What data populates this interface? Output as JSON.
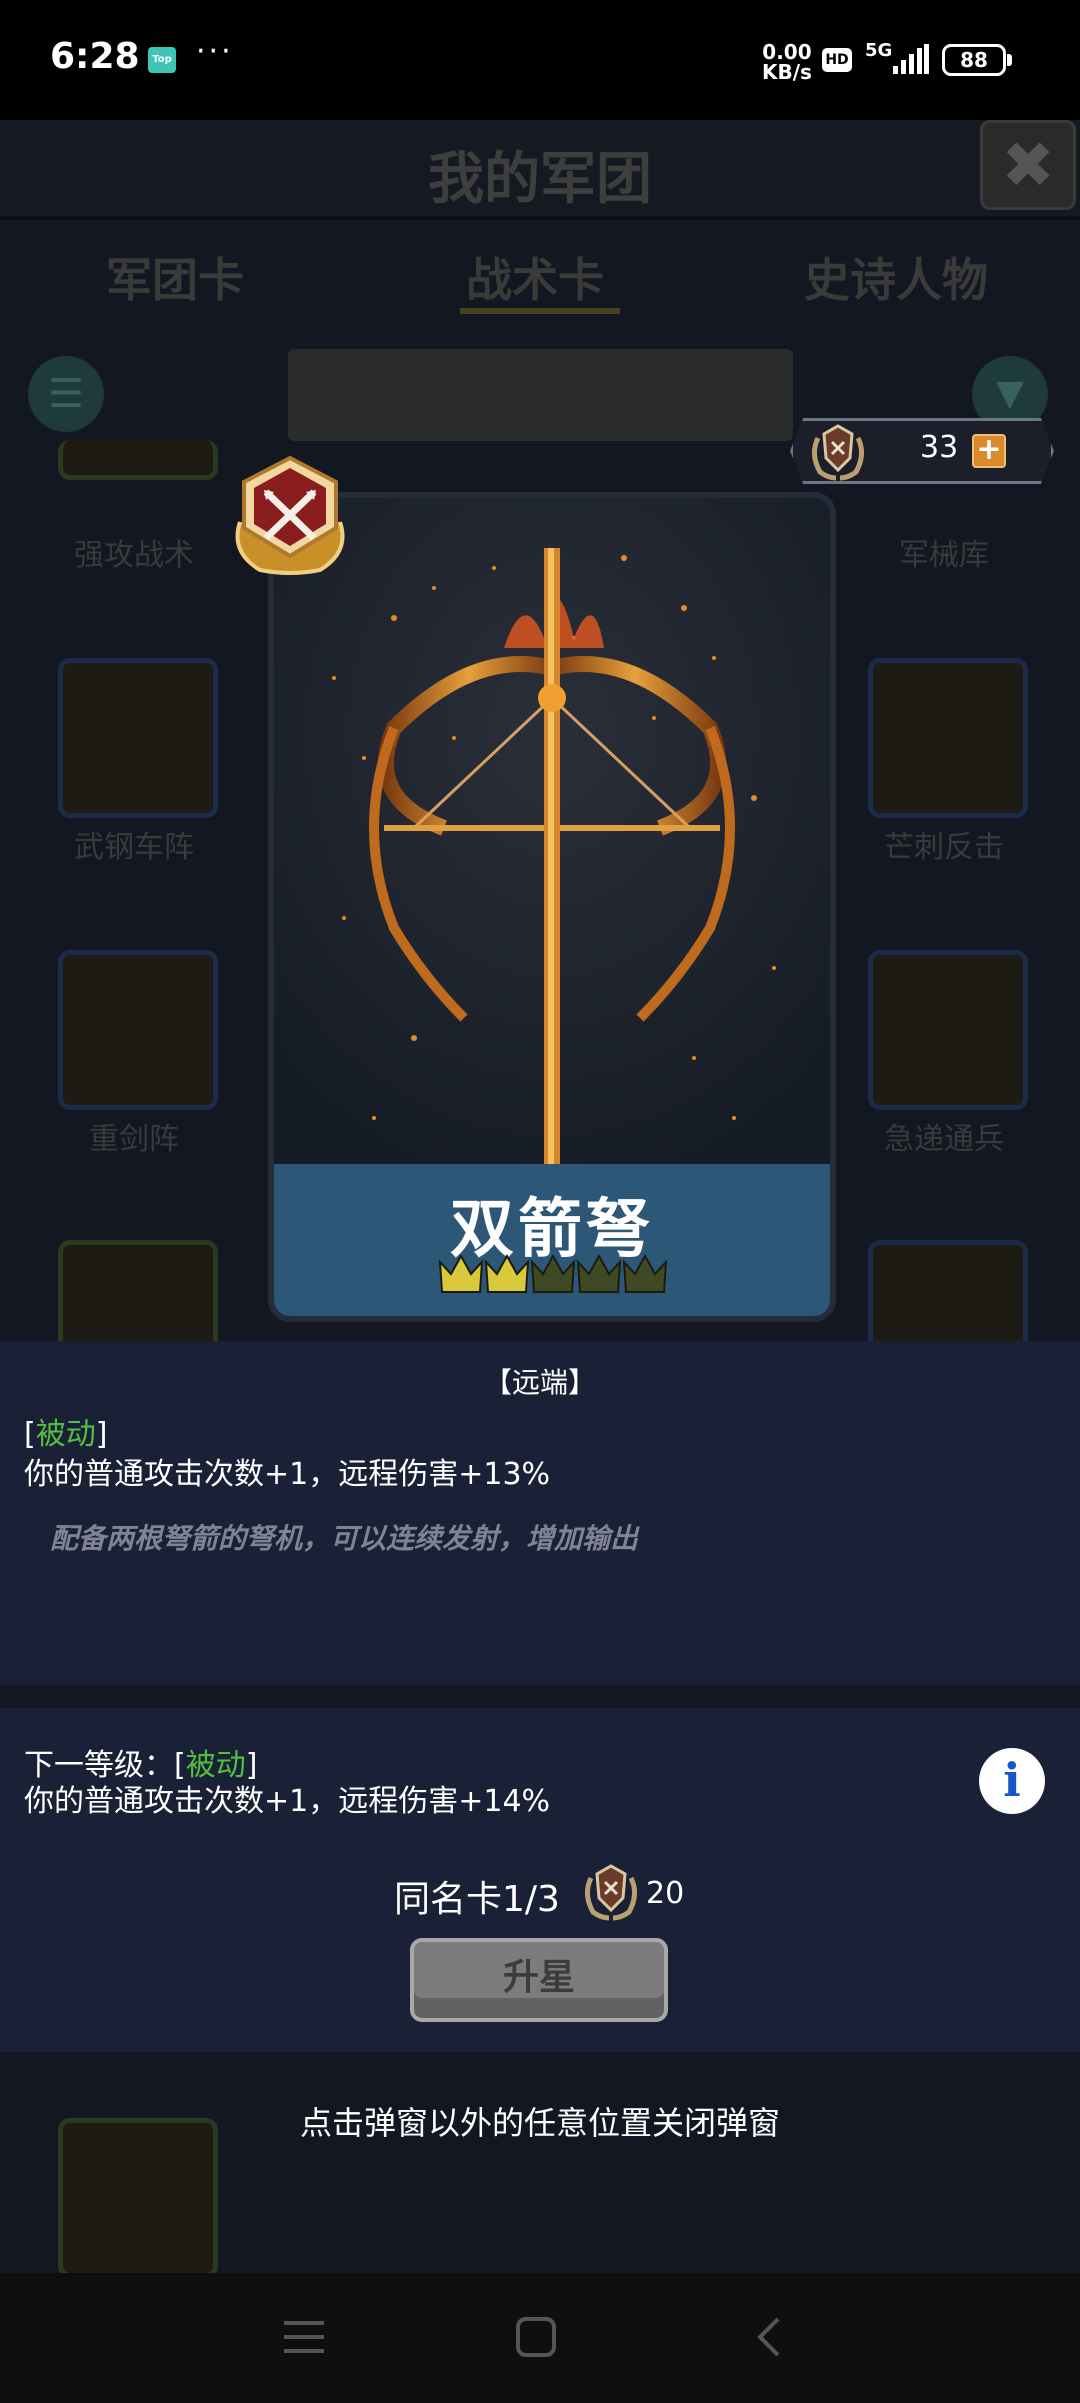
{
  "status_bar": {
    "time": "6:28",
    "app_badge": "Top",
    "more": "···",
    "net_speed_value": "0.00",
    "net_speed_unit": "KB/s",
    "hd": "HD",
    "network": "5G",
    "battery": "88"
  },
  "background": {
    "title": "我的军团",
    "close_glyph": "✖",
    "tabs": [
      "军团卡",
      "战术卡",
      "史诗人物"
    ],
    "active_tab": "战术卡",
    "cards": [
      "强攻战术",
      "军械库",
      "武钢车阵",
      "芒刺反击",
      "重剑阵",
      "急递通兵"
    ]
  },
  "currency": {
    "amount": "33",
    "plus": "+",
    "icon": "laurel-shield-emblem-icon"
  },
  "card": {
    "name": "双箭弩",
    "type_icon": "crossed-arrows-badge-icon",
    "crowns_total": 5,
    "crowns_lit": 2,
    "colors": {
      "crown_gold": "#d8c83a",
      "crown_dim": "#3f4a24",
      "nameplate": "#2c5776"
    }
  },
  "current": {
    "tag": "【远端】",
    "bracket_open": "[",
    "mode": "被动",
    "bracket_close": "]",
    "effect": "你的普通攻击次数+1，远程伤害+13%",
    "flavor": "配备两根弩箭的弩机，可以连续发射，增加输出"
  },
  "next_level": {
    "prefix": "下一等级：[",
    "mode": "被动",
    "bracket_close": "]",
    "effect": "你的普通攻击次数+1，远程伤害+14%",
    "info_glyph": "i"
  },
  "duplicate": {
    "label": "同名卡1/3",
    "cost": "20"
  },
  "buttons": {
    "star_up": "升星"
  },
  "hint": "点击弹窗以外的任意位置关闭弹窗",
  "nav": {
    "menu_icon": "menu-icon",
    "home_icon": "home-icon",
    "back_icon": "back-icon"
  }
}
